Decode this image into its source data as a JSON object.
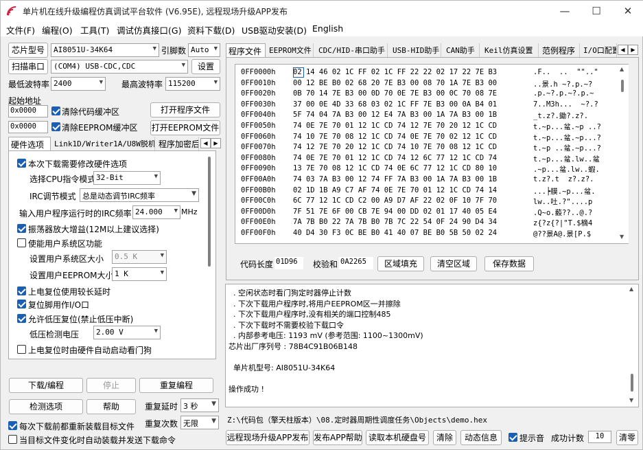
{
  "window": {
    "title": "单片机在线升级编程仿真调试平台软件 (V6.95E), 远程现场升级APP发布",
    "minimize": "—",
    "maximize": "☐",
    "close": "✕"
  },
  "menu": [
    "文件(F)",
    "编程(O)",
    "工具(T)",
    "调试仿真接口(G)",
    "资料下载(D)",
    "USB驱动安装(D)",
    "English"
  ],
  "left": {
    "chip_label": "芯片型号",
    "chip_value": "AI8051U-34K64",
    "ref_label": "引脚数",
    "ref_value": "Auto",
    "scan_button": "扫描串口",
    "port_value": "(COM4) USB-CDC,CDC",
    "settings_button": "设置",
    "min_baud_label": "最低波特率",
    "min_baud_value": "2400",
    "max_baud_label": "最高波特率",
    "max_baud_value": "115200",
    "start_addr_label": "起始地址",
    "addr1_value": "0x0000",
    "clear_code_label": "清除代码缓冲区",
    "open_prog_button": "打开程序文件",
    "addr2_value": "0x0000",
    "clear_eeprom_label": "清除EEPROM缓冲区",
    "open_eeprom_button": "打开EEPROM文件",
    "tabs": [
      "硬件选项",
      "Link1D/Writer1A/U8W脱机",
      "程序加密后"
    ],
    "hw": {
      "modify_hw": "本次下载需要修改硬件选项",
      "cpu_mode_label": "选择CPU指令模式",
      "cpu_mode_value": "32-Bit",
      "irc_mode_label": "IRC调节模式",
      "irc_mode_value": "总是动态调节IRC频率",
      "irc_freq_label": "输入用户程序运行时的IRC频率",
      "irc_freq_value": "24.000",
      "irc_freq_unit": "MHz",
      "osc_gain": "振荡器放大增益(12M以上建议选择)",
      "user_sys": "使能用户系统区功能",
      "sys_size_label": "设置用户系统区大小",
      "sys_size_value": "0.5 K",
      "eeprom_size_label": "设置用户EEPROM大小",
      "eeprom_size_value": "1   K",
      "long_delay": "上电复位使用较长延时",
      "reset_io": "复位脚用作I/O口",
      "lvr": "允许低压复位(禁止低压中断)",
      "lvd_label": "低压检测电压",
      "lvd_value": "2.00 V",
      "wdt": "上电复位时由硬件自动启动看门狗"
    },
    "download_button": "下载/编程",
    "stop_button": "停止",
    "reprogram_button": "重复编程",
    "check_button": "检测选项",
    "help_button": "帮助",
    "repeat_delay_label": "重复延时",
    "repeat_delay_value": "3 秒",
    "repeat_count_label": "重复次数",
    "repeat_count_value": "无限",
    "reload_each": "每次下载前都重新装载目标文件",
    "auto_reload": "当目标文件变化时自动装载并发送下载命令"
  },
  "right": {
    "tabs": [
      "程序文件",
      "EEPROM文件",
      "CDC/HID-串口助手",
      "USB-HID助手",
      "CAN助手",
      "Keil仿真设置",
      "范例程序",
      "I/O口配置"
    ],
    "hex_rows": [
      {
        "addr": "0FF0000h",
        "bytes": "02 14 46 02 1C FF 02 1C FF 22 22 02 17 22 7E B3",
        "ascii": ".F..  ..  \"\"..\""
      },
      {
        "addr": "0FF0010h",
        "bytes": "00 12 BE B0 02 68 20 7E B3 00 08 70 1A 7E B3 00",
        "ascii": "..景.h ~?.p.~?"
      },
      {
        "addr": "0FF0020h",
        "bytes": "0B 70 14 7E B3 00 0D 70 0E 7E B3 00 0C 70 08 7E",
        "ascii": ".p.~?.p.~?.p.~"
      },
      {
        "addr": "0FF0030h",
        "bytes": "37 00 0E 4D 33 68 03 02 1C FF 7E B3 00 0A B4 01",
        "ascii": "7..M3h...  ~?.?"
      },
      {
        "addr": "0FF0040h",
        "bytes": "5F 74 04 7A B3 00 12 E4 7A B3 00 1A 7A B3 00 1B",
        "ascii": "_t.z?.鋤?.z?."
      },
      {
        "addr": "0FF0050h",
        "bytes": "74 0E 7E 70 01 12 1C CD 74 12 7E 70 20 12 1C CD",
        "ascii": "t.~p...蚠.~p ..?"
      },
      {
        "addr": "0FF0060h",
        "bytes": "74 10 7E 70 08 12 1C CD 74 0E 7E 70 02 12 1C CD",
        "ascii": "t.~p...蚠.~p...?"
      },
      {
        "addr": "0FF0070h",
        "bytes": "74 12 7E 70 20 12 1C CD 74 10 7E 70 08 12 1C CD",
        "ascii": "t.~p ..蚠.~p...?"
      },
      {
        "addr": "0FF0080h",
        "bytes": "74 0E 7E 70 01 12 1C CD 74 12 6C 77 12 1C CD 74",
        "ascii": "t.~p...蚠.lw..蚠"
      },
      {
        "addr": "0FF0090h",
        "bytes": "13 7E 70 08 12 1C CD 74 0E 6C 77 12 1C CD 80 10",
        "ascii": ".~p...蚠.lw..蝦."
      },
      {
        "addr": "0FF00A0h",
        "bytes": "74 03 7A B3 00 12 74 FF 7A B3 00 1A 7A B3 00 1B",
        "ascii": "t.z?.t  z?.z?."
      },
      {
        "addr": "0FF00B0h",
        "bytes": "02 1D 1B A9 C7 AF 74 0E 7E 70 01 12 1C CD 74 14",
        "ascii": "...┝膜.~p...蚠."
      },
      {
        "addr": "0FF00C0h",
        "bytes": "6C 77 12 1C CD C2 00 A9 D7 AF 22 02 0F 10 7F 70",
        "ascii": "lw..吐.?\"....p"
      },
      {
        "addr": "0FF00D0h",
        "bytes": "7F 51 7E 6F 00 CB 7E 94 00 DD 02 01 17 40 05 E4",
        "ascii": ".Q~o.藙??..@.?"
      },
      {
        "addr": "0FF00E0h",
        "bytes": "7A 7B B0 22 7A 7B B0 7B 7C 22 54 0F 24 90 D4 34",
        "ascii": "z{?z{?|\"T.$樀4"
      },
      {
        "addr": "0FF00F0h",
        "bytes": "40 D4 30 F3 0C BE B0 41 40 07 BE B0 5B 50 02 24",
        "ascii": "@??景A@.景[P.$"
      }
    ],
    "code_len_label": "代码长度",
    "code_len_value": "01D96",
    "checksum_label": "校验和",
    "checksum_value": "0A2265",
    "fill_button": "区域填充",
    "clear_button": "清空区域",
    "save_button": "保存数据",
    "log_lines": [
      "  . 空闲状态时看门狗定时器停止计数",
      "  . 下次下载用户程序时,将用户EEPROM区一并擦除",
      "  . 下次下载用户程序时,没有相关的端口控制485",
      "  . 下次下载时不需要校验下载口令",
      "  . 内部参考电压: 1193 mV (参考范围: 1100~1300mV)",
      "芯片出厂序列号 : 78B4C91B06B148",
      "",
      "  单片机型号: AI8051U-34K64",
      "",
      "操作成功 !"
    ],
    "path": "Z:\\代码包（擎天柱版本）\\08.定时器周期性调度任务\\Objects\\demo.hex",
    "remote_button": "远程现场升级APP发布",
    "publish_help_button": "发布APP帮助",
    "read_disk_button": "读取本机硬盘号",
    "clear_log_button": "清除",
    "anim_button": "动态信息",
    "sound_label": "提示音",
    "success_label": "成功计数",
    "success_value": "10",
    "reset_count_button": "清零"
  }
}
